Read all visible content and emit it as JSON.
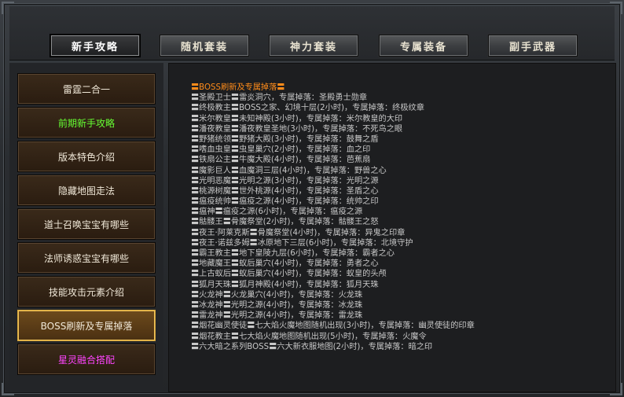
{
  "tabs": [
    {
      "label": "新手攻略",
      "active": true
    },
    {
      "label": "随机套装",
      "active": false
    },
    {
      "label": "神力套装",
      "active": false
    },
    {
      "label": "专属装备",
      "active": false
    },
    {
      "label": "副手武器",
      "active": false
    }
  ],
  "sidebar": {
    "items": [
      {
        "label": "雷霆二合一",
        "color": "#f0e8d8"
      },
      {
        "label": "前期新手攻略",
        "color": "#66ff33"
      },
      {
        "label": "版本特色介绍",
        "color": "#f0e8d8"
      },
      {
        "label": "隐藏地图走法",
        "color": "#f0e8d8"
      },
      {
        "label": "道士召唤宝宝有哪些",
        "color": "#f0e8d8"
      },
      {
        "label": "法师诱惑宝宝有哪些",
        "color": "#f0e8d8"
      },
      {
        "label": "技能攻击元素介绍",
        "color": "#f0e8d8"
      },
      {
        "label": "BOSS刷新及专属掉落",
        "color": "#f0e8d8",
        "active": true
      },
      {
        "label": "星灵融合搭配",
        "color": "#ff44ff"
      }
    ]
  },
  "content": {
    "heading": "〓BOSS刷新及专属掉落〓",
    "lines": [
      "〓圣殿卫士〓雷炎洞穴，专属掉落：圣殿勇士勋章",
      "〓终极教主〓BOSS之家、幻境十层(2小时)，专属掉落：终极纹章",
      "〓米尔教皇〓未知神殿(3小时)，专属掉落：米尔教皇的大印",
      "〓潘夜教皇〓潘夜教皇圣地(3小时)，专属掉落：不死鸟之眼",
      "〓野猪统领〓野猪大殿(3小时)，专属掉落：鼓舞之盾",
      "〓嗜血虫皇〓虫皇巢穴(2小时)，专属掉落：血之印",
      "〓铁扇公主〓牛魔大殿(4小时)，专属掉落：芭蕉扇",
      "〓魔影巨人〓血魔洞三层(4小时)，专属掉落：野兽之心",
      "〓光明恶魔〓光明之源(3小时)，专属掉落：光明之源",
      "〓桃源树魔〓世外桃源(4小时)，专属掉落：圣盾之心",
      "〓瘟疫统帅〓瘟疫之源(4小时)，专属掉落：统帅之印",
      "〓瘟神〓瘟疫之源(6小时)，专属掉落：瘟疫之源",
      "〓骷髅王〓骨魔祭堂(2小时)，专属掉落：骷髅王之怒",
      "〓夜王·阿莱克斯〓骨魔祭堂(4小时)，专属掉落：异鬼之印章",
      "〓夜王·诺兹多姆〓冰原地下三层(6小时)，专属掉落：北境守护",
      "〓霸王教主〓地下皇陵九层(6小时)，专属掉落：霸者之心",
      "〓地藏魔王〓蚁后巢穴(4小时)，专属掉落：勇者之心",
      "〓上古蚁后〓蚁后巢穴(4小时)，专属掉落：蚁皇的头颅",
      "〓狐月天珠〓狐月神殿(4小时)，专属掉落：狐月天珠",
      "〓火龙神〓火龙巢穴(4小时)，专属掉落：火龙珠",
      "〓冰龙神〓光明之源(4小时)，专属掉落：冰龙珠",
      "〓雷龙神〓光明之源(4小时)，专属掉落：雷龙珠",
      "〓烟花幽灵使徒〓七大焰火魔地图随机出现(3小时)，专属掉落：幽灵使徒的印章",
      "〓烟花教主〓七大焰火魔地图随机出现(5小时)，专属掉落：火魔令",
      "〓六大暗之系列BOSS〓六大新衣服地图(2小时)，专属掉落：暗之印"
    ]
  },
  "colors": {
    "heading": "#ff8c1a",
    "text": "#c8c8c8",
    "active_border": "#d6a53a"
  }
}
